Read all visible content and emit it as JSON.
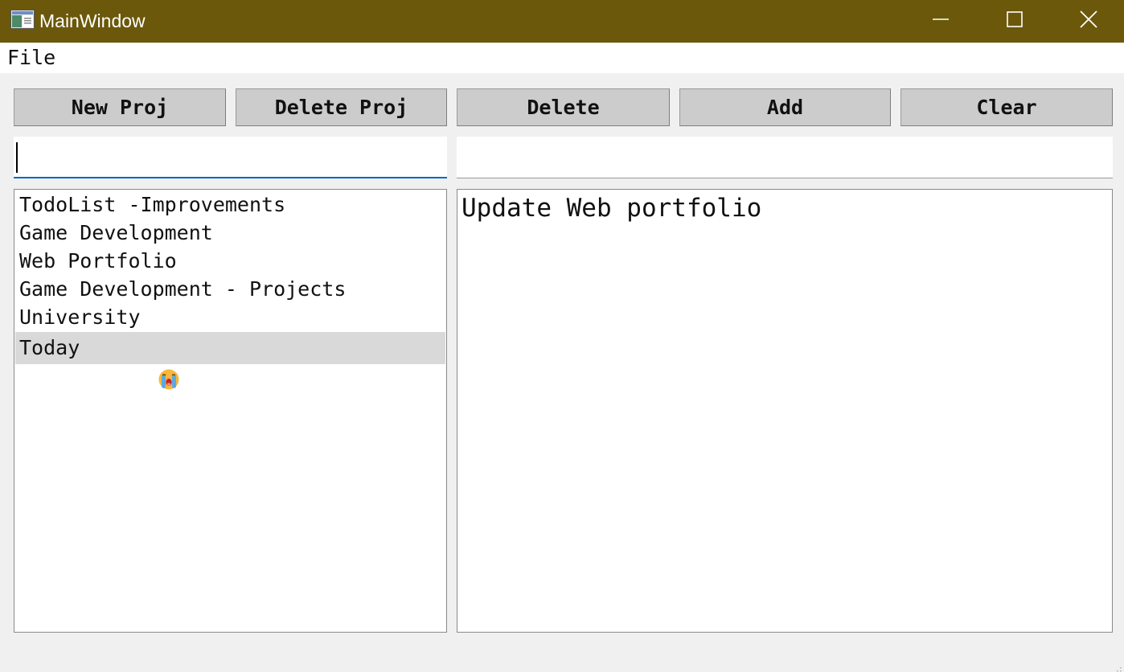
{
  "window": {
    "title": "MainWindow",
    "title_bar_color": "#6b580b",
    "controls": [
      "minimize-icon",
      "maximize-icon",
      "close-icon"
    ]
  },
  "menu": {
    "items": [
      "File"
    ]
  },
  "toolbar": {
    "new_proj": "New Proj",
    "delete_proj": "Delete Proj",
    "delete": "Delete",
    "add": "Add",
    "clear": "Clear"
  },
  "inputs": {
    "project_value": "",
    "task_value": ""
  },
  "projects": [
    {
      "label": "TodoList -Improvements"
    },
    {
      "label": "Game Development"
    },
    {
      "label": "Web Portfolio"
    },
    {
      "label": "Game Development - Projects"
    },
    {
      "label": "University"
    },
    {
      "label": "Today",
      "icon": "crying-face-emoji-icon",
      "selected": true
    }
  ],
  "tasks": [
    {
      "label": "Update Web portfolio"
    }
  ],
  "colors": {
    "accent": "#0067c0",
    "selection": "#d9d9d9",
    "button": "#cccccc"
  }
}
